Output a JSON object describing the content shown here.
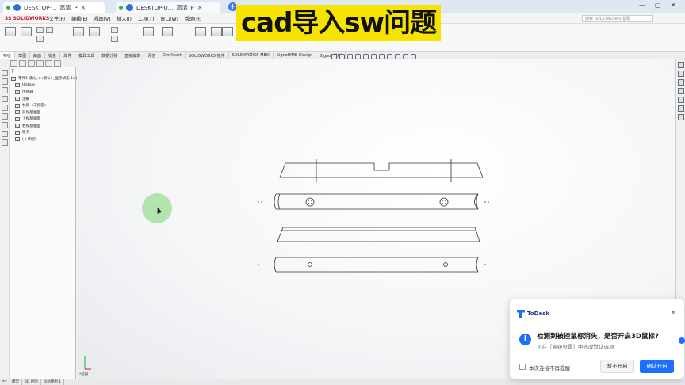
{
  "browser_tabs": [
    {
      "title": "DESKTOP-...",
      "subtitle": "高清",
      "mode": "P",
      "close": "×"
    },
    {
      "title": "DESKTOP-U...",
      "subtitle": "高清",
      "mode": "P",
      "close": "×"
    }
  ],
  "new_tab": "+",
  "window_controls": {
    "minimize": "—",
    "maximize": "▢",
    "close": "✕"
  },
  "app": {
    "logo": "3S SOLIDWORKS"
  },
  "menu": [
    "文件(F)",
    "编辑(E)",
    "视图(V)",
    "插入(I)",
    "工具(T)",
    "窗口(W)",
    "帮助(H)"
  ],
  "search_placeholder": "搜索 SOLIDWORKS 帮助",
  "command_tabs": [
    "特征",
    "草图",
    "曲面",
    "钣金",
    "焊件",
    "模具工具",
    "数据迁移",
    "直接编辑",
    "评估",
    "DimXpert",
    "SOLIDWORKS 插件",
    "SOLIDWORKS MBD",
    "SignoffIMB Design",
    "Signoff模板"
  ],
  "feature_tree": {
    "filter_icon": "⊽",
    "root": "零件1 (默认<<默认>_显示状态 1>)",
    "items": [
      "History",
      "传感器",
      "注解",
      "材质 <未指定>",
      "前视基准面",
      "上视基准面",
      "右视基准面",
      "原点",
      "(-) 草图1"
    ]
  },
  "status_bar": {
    "nav": "◂ ▸",
    "tabs": [
      "模型",
      "3D 视图",
      "运动算例 1"
    ]
  },
  "triad_label": "*前视",
  "overlay_title": "cad导入sw问题",
  "dialog": {
    "brand": "ToDesk",
    "close": "×",
    "info_symbol": "i",
    "title": "检测到被控鼠标消失，是否开启3D鼠标?",
    "subtitle": "可在［高级设置］中修改默认选项",
    "checkbox_label": "本次连接不再提醒",
    "checkbox_checked": false,
    "secondary_button": "暂不开启",
    "primary_button": "确认开启",
    "accent_color": "#1f6fff"
  },
  "highlight_color": "#f6e300"
}
